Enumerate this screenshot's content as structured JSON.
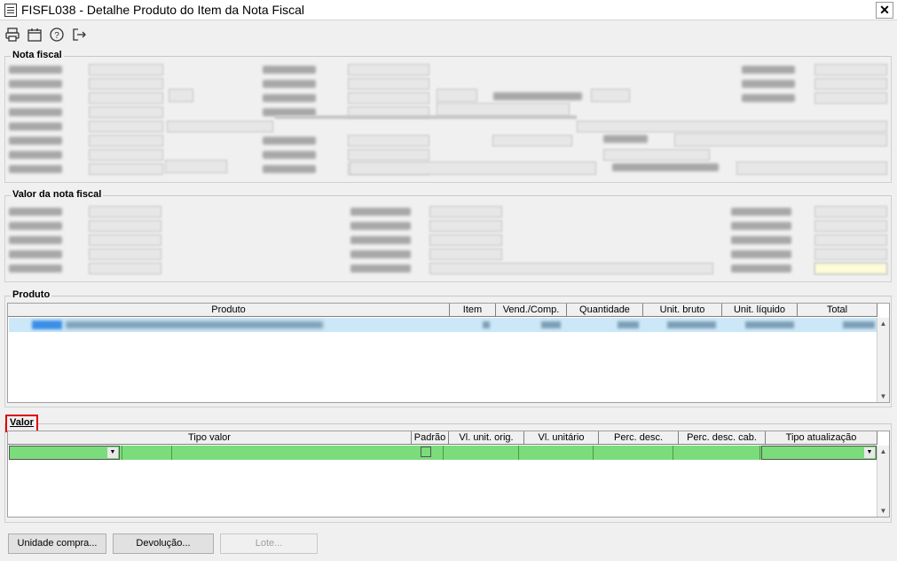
{
  "window": {
    "title": "FISFL038 - Detalhe Produto do Item da Nota Fiscal",
    "close_glyph": "✕"
  },
  "toolbar": {
    "icons": [
      "printer-icon",
      "calendar-icon",
      "help-icon",
      "exit-icon"
    ]
  },
  "sections": {
    "nota_fiscal": "Nota fiscal",
    "valor_nota": "Valor da nota fiscal",
    "produto": "Produto",
    "valor": "Valor"
  },
  "produto_grid": {
    "columns": [
      "Produto",
      "Item",
      "Vend./Comp.",
      "Quantidade",
      "Unit. bruto",
      "Unit. líquido",
      "Total"
    ]
  },
  "valor_grid": {
    "columns": [
      "Tipo valor",
      "Padrão",
      "Vl. unit. orig.",
      "Vl. unitário",
      "Perc. desc.",
      "Perc. desc. cab.",
      "Tipo atualização"
    ],
    "row_color": "#7bdc7b"
  },
  "buttons": {
    "unidade_compra": "Unidade compra...",
    "devolucao": "Devolução...",
    "lote": "Lote..."
  },
  "colors": {
    "selection_row": "#cce8f8",
    "highlight_border": "#e00000",
    "total_field": "#fdfbd8"
  }
}
